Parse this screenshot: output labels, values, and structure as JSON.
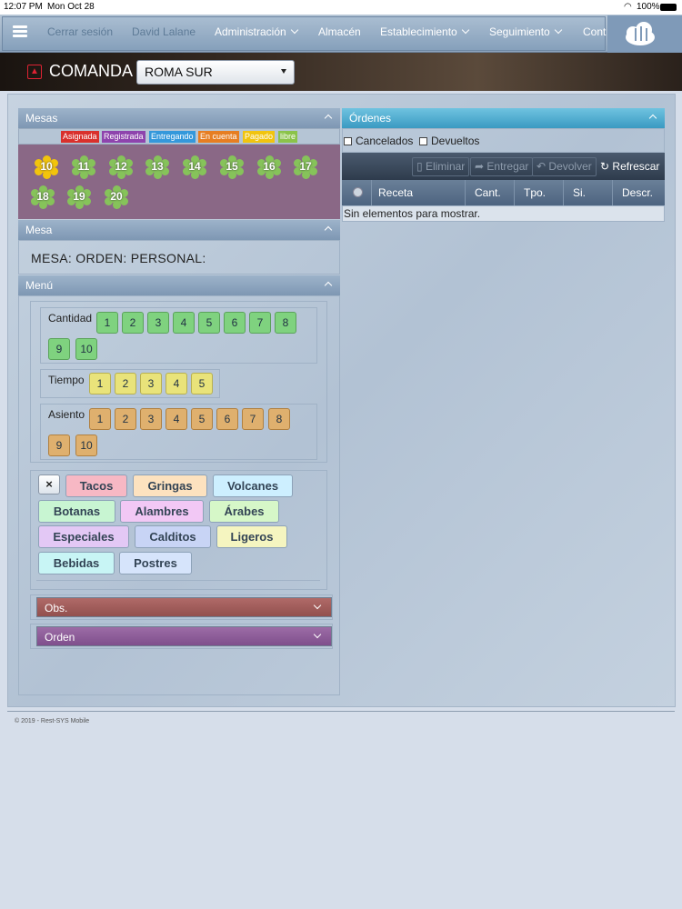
{
  "status": {
    "time": "12:07 PM",
    "date": "Mon Oct 28",
    "battery": "100%"
  },
  "nav": {
    "items": [
      {
        "label": "Cerrar sesión"
      },
      {
        "label": "David Lalane"
      },
      {
        "label": "Administración"
      },
      {
        "label": "Almacén"
      },
      {
        "label": "Establecimiento"
      },
      {
        "label": "Seguimiento"
      },
      {
        "label": "Cont"
      }
    ]
  },
  "header": {
    "title": "COMANDA",
    "branch": "ROMA SUR"
  },
  "mesas": {
    "title": "Mesas",
    "legend": [
      {
        "label": "Asignada",
        "color": "#d9302c"
      },
      {
        "label": "Registrada",
        "color": "#8e44ad"
      },
      {
        "label": "Entregando",
        "color": "#3498db"
      },
      {
        "label": "En cuenta",
        "color": "#e67e22"
      },
      {
        "label": "Pagado",
        "color": "#f1c40f"
      },
      {
        "label": "libre",
        "color": "#8bc34a"
      }
    ],
    "tables": [
      "10",
      "11",
      "12",
      "13",
      "14",
      "15",
      "16",
      "17",
      "18",
      "19",
      "20"
    ],
    "selected": "10"
  },
  "mesa": {
    "title": "Mesa",
    "line": "MESA:  ORDEN:  PERSONAL:"
  },
  "menu": {
    "title": "Menú",
    "cantidad_label": "Cantidad",
    "cantidad": [
      "1",
      "2",
      "3",
      "4",
      "5",
      "6",
      "7",
      "8",
      "9",
      "10"
    ],
    "tiempo_label": "Tiempo",
    "tiempo": [
      "1",
      "2",
      "3",
      "4",
      "5"
    ],
    "asiento_label": "Asiento",
    "asiento": [
      "1",
      "2",
      "3",
      "4",
      "5",
      "6",
      "7",
      "8",
      "9",
      "10"
    ],
    "clear": "×",
    "categories": [
      {
        "label": "Tacos",
        "color": "#f7b8c4"
      },
      {
        "label": "Gringas",
        "color": "#fde2bf"
      },
      {
        "label": "Volcanes",
        "color": "#cdefff"
      },
      {
        "label": "Botanas",
        "color": "#c8f5d2"
      },
      {
        "label": "Alambres",
        "color": "#f2c8f5"
      },
      {
        "label": "Árabes",
        "color": "#d6f7c8"
      },
      {
        "label": "Especiales",
        "color": "#e3c8f5"
      },
      {
        "label": "Calditos",
        "color": "#c8d4f5"
      },
      {
        "label": "Ligeros",
        "color": "#f5f5c0"
      },
      {
        "label": "Bebidas",
        "color": "#c8f5f5"
      },
      {
        "label": "Postres",
        "color": "#d6e4fb"
      }
    ],
    "obs": "Obs.",
    "orden": "Orden"
  },
  "ordenes": {
    "title": "Órdenes",
    "cancelados": "Cancelados",
    "devueltos": "Devueltos",
    "toolbar": {
      "eliminar": "Eliminar",
      "entregar": "Entregar",
      "devolver": "Devolver",
      "refrescar": "Refrescar"
    },
    "columns": [
      "Receta",
      "Cant.",
      "Tpo.",
      "Si.",
      "Descr."
    ],
    "empty": "Sin elementos para mostrar."
  },
  "footer": "© 2019 - Rest-SYS Mobile"
}
